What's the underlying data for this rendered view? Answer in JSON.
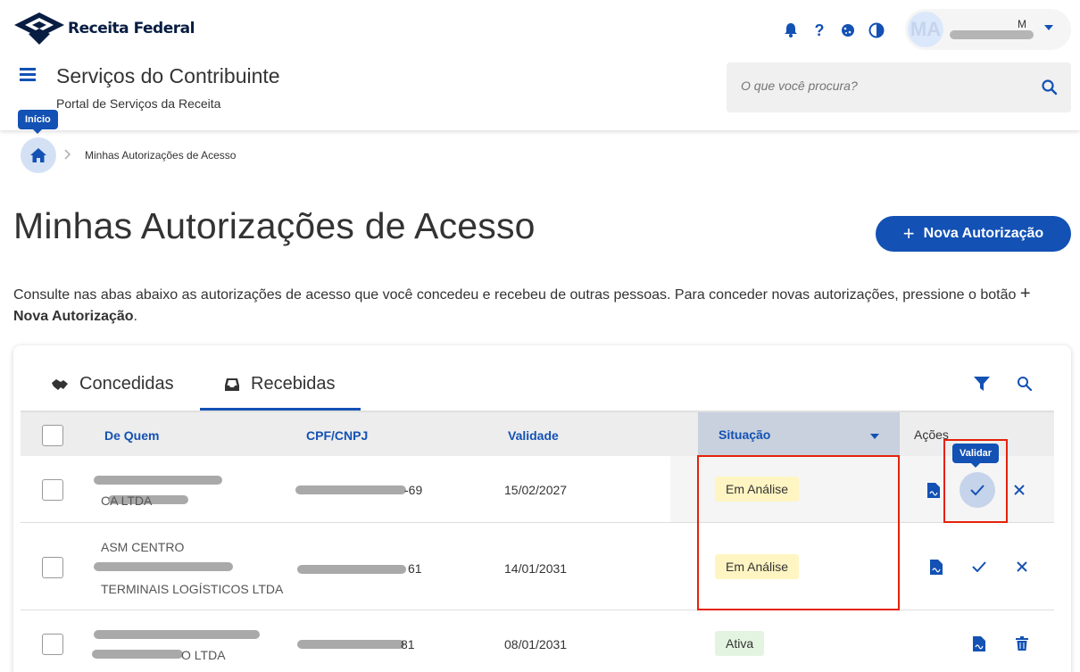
{
  "header": {
    "brand": "Receita Federal",
    "site_title": "Serviços do Contribuinte",
    "site_subtitle": "Portal de Serviços da Receita",
    "user_initials": "MA",
    "user_initial_top": "M",
    "icons": [
      "bell-icon",
      "help-icon",
      "cookie-icon",
      "contrast-icon"
    ],
    "search_placeholder": "O que você procura?"
  },
  "breadcrumb": {
    "home_tooltip": "Início",
    "current": "Minhas Autorizações de Acesso"
  },
  "page": {
    "title": "Minhas Autorizações de Acesso",
    "new_button": "Nova Autorização",
    "description_text": "Consulte nas abas abaixo as autorizações de acesso que você concedeu e recebeu de outras pessoas. Para conceder novas autorizações, pressione o botão",
    "description_button": "Nova Autorização",
    "description_end": "."
  },
  "tabs": [
    {
      "label": "Concedidas",
      "active": false
    },
    {
      "label": "Recebidas",
      "active": true
    }
  ],
  "table": {
    "columns": {
      "from": "De Quem",
      "doc": "CPF/CNPJ",
      "validity": "Validade",
      "status": "Situação",
      "actions": "Ações"
    },
    "rows": [
      {
        "name_visible": "CA        LTDA",
        "doc_suffix": "-69",
        "validity": "15/02/2027",
        "status": "Em Análise"
      },
      {
        "name_visible": "TERMINAIS LOGÍSTICOS LTDA",
        "name_top": "ASM CENTRO",
        "doc_suffix": "61",
        "validity": "14/01/2031",
        "status": "Em Análise"
      },
      {
        "name_visible": "O LTDA",
        "doc_suffix": "81",
        "validity": "08/01/2031",
        "status": "Ativa"
      }
    ],
    "validate_tooltip": "Validar"
  },
  "colors": {
    "primary": "#1351b4",
    "highlight": "#e52207",
    "status_pending_bg": "#fff5c2",
    "status_active_bg": "#e3f5e1"
  }
}
